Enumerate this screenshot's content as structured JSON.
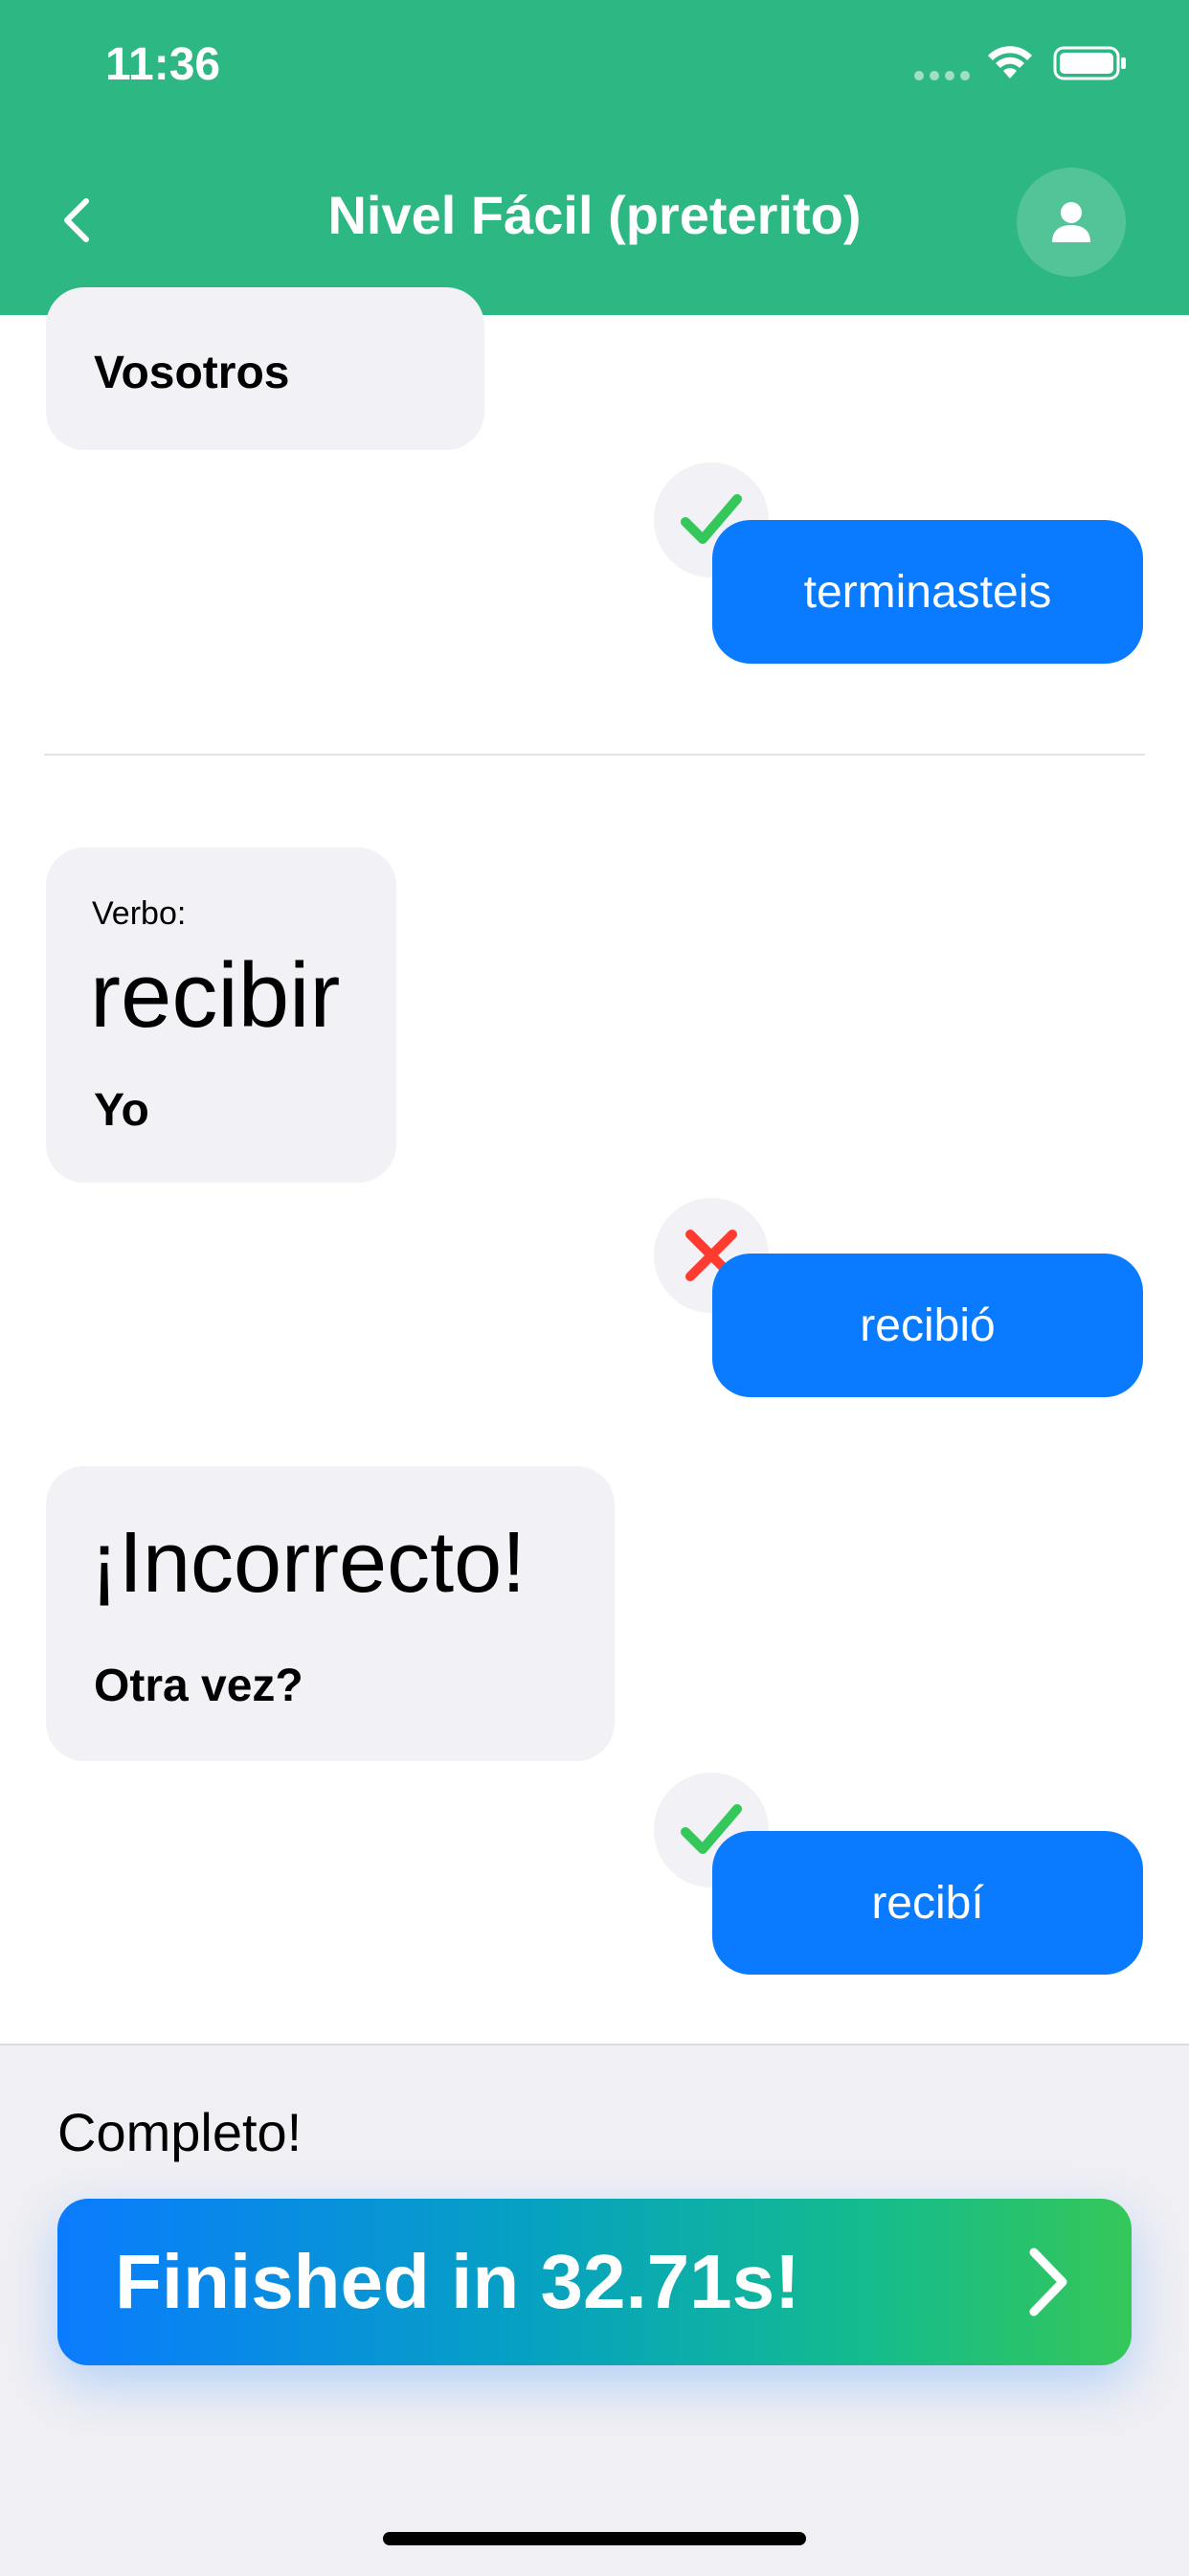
{
  "status_bar": {
    "time": "11:36"
  },
  "header": {
    "title": "Nivel Fácil (preterito)"
  },
  "chat": {
    "prev_pronoun": "Vosotros",
    "prev_answer": "terminasteis",
    "question": {
      "verb_label": "Verbo:",
      "verb": "recibir",
      "pronoun": "Yo"
    },
    "attempt1": {
      "answer": "recibió",
      "result": "incorrect"
    },
    "feedback": {
      "title": "¡Incorrecto!",
      "subtitle": "Otra vez?"
    },
    "attempt2": {
      "answer": "recibí",
      "result": "correct"
    }
  },
  "footer": {
    "complete_label": "Completo!",
    "finish_text": "Finished in 32.71s!"
  },
  "colors": {
    "header": "#2db782",
    "bubble_user": "#0a7bfe",
    "bubble_app": "#f1f1f6",
    "correct": "#34c759",
    "incorrect": "#ff3b30"
  }
}
